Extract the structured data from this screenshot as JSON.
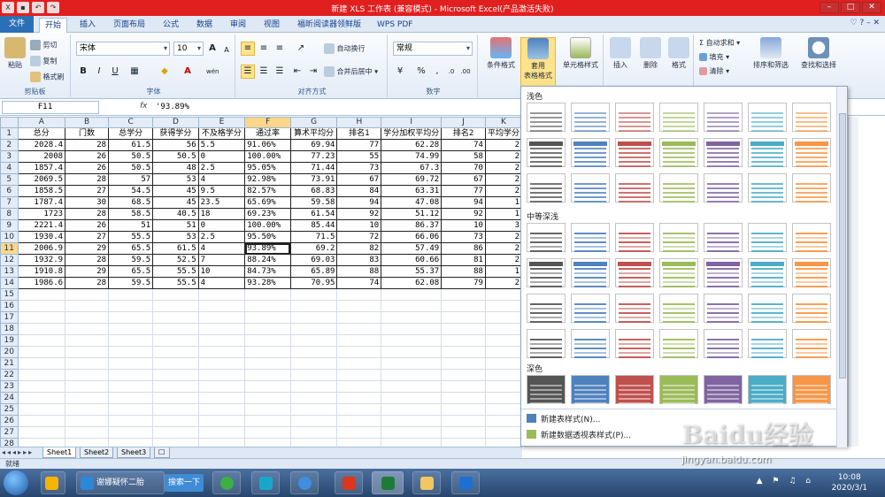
{
  "window": {
    "title": "新建 XLS 工作表 (兼容模式) - Microsoft Excel(产品激活失败)",
    "controls": [
      "–",
      "□",
      "✕"
    ]
  },
  "tabs": [
    {
      "label": "文件"
    },
    {
      "label": "开始"
    },
    {
      "label": "插入"
    },
    {
      "label": "页面布局"
    },
    {
      "label": "公式"
    },
    {
      "label": "数据"
    },
    {
      "label": "审阅"
    },
    {
      "label": "视图"
    },
    {
      "label": "福昕阅读器领鲜版"
    },
    {
      "label": "WPS PDF"
    }
  ],
  "ribbon": {
    "clipboard": {
      "label": "剪贴板",
      "paste": "粘贴",
      "cut": "剪切",
      "copy": "复制",
      "format_painter": "格式刷"
    },
    "font": {
      "label": "字体",
      "name": "宋体",
      "size": "10",
      "bold": "B",
      "italic": "I",
      "underline": "U",
      "grow": "A",
      "shrink": "A",
      "wen": "wén"
    },
    "alignment": {
      "label": "对齐方式",
      "wrap": "自动换行",
      "merge": "合并后居中"
    },
    "number": {
      "label": "数字",
      "format": "常规",
      "percent": "%",
      "comma": ","
    },
    "styles": {
      "conditional": "条件格式",
      "table_line1": "套用",
      "table_line2": "表格格式",
      "cell": "单元格样式"
    },
    "cells": {
      "insert": "插入",
      "delete": "删除",
      "format": "格式"
    },
    "editing": {
      "autosum": "自动求和",
      "fill": "填充",
      "clear": "清除",
      "sort": "排序和筛选",
      "find": "查找和选择"
    }
  },
  "formula_bar": {
    "name_box": "F11",
    "fx": "fx",
    "content": "'93.89%"
  },
  "sheet": {
    "columns": [
      "A",
      "B",
      "C",
      "D",
      "E",
      "F",
      "G",
      "H",
      "I",
      "J",
      "K"
    ],
    "header_row": [
      "总分",
      "门数",
      "总学分",
      "获得学分",
      "不及格学分",
      "通过率",
      "算术平均分",
      "排名1",
      "学分加权平均分",
      "排名2",
      "平均学分"
    ],
    "rows": [
      [
        "2028.4",
        "28",
        "61.5",
        "56",
        "5.5",
        "91.06%",
        "69.94",
        "77",
        "62.28",
        "74",
        "2"
      ],
      [
        "2008",
        "26",
        "50.5",
        "50.5",
        "0",
        "100.00%",
        "77.23",
        "55",
        "74.99",
        "58",
        "2"
      ],
      [
        "1857.4",
        "26",
        "50.5",
        "48",
        "2.5",
        "95.05%",
        "71.44",
        "73",
        "67.3",
        "70",
        "2"
      ],
      [
        "2069.5",
        "28",
        "57",
        "53",
        "4",
        "92.98%",
        "73.91",
        "67",
        "69.72",
        "67",
        "2"
      ],
      [
        "1858.5",
        "27",
        "54.5",
        "45",
        "9.5",
        "82.57%",
        "68.83",
        "84",
        "63.31",
        "77",
        "2"
      ],
      [
        "1787.4",
        "30",
        "68.5",
        "45",
        "23.5",
        "65.69%",
        "59.58",
        "94",
        "47.08",
        "94",
        "1"
      ],
      [
        "1723",
        "28",
        "58.5",
        "40.5",
        "18",
        "69.23%",
        "61.54",
        "92",
        "51.12",
        "92",
        "1"
      ],
      [
        "2221.4",
        "26",
        "51",
        "51",
        "0",
        "100.00%",
        "85.44",
        "10",
        "86.37",
        "10",
        "3"
      ],
      [
        "1930.4",
        "27",
        "55.5",
        "53",
        "2.5",
        "95.50%",
        "71.5",
        "72",
        "66.06",
        "73",
        "2"
      ],
      [
        "2006.9",
        "29",
        "65.5",
        "61.5",
        "4",
        "93.89%",
        "69.2",
        "82",
        "57.49",
        "86",
        "2"
      ],
      [
        "1932.9",
        "28",
        "59.5",
        "52.5",
        "7",
        "88.24%",
        "69.03",
        "83",
        "60.66",
        "81",
        "2"
      ],
      [
        "1910.8",
        "29",
        "65.5",
        "55.5",
        "10",
        "84.73%",
        "65.89",
        "88",
        "55.37",
        "88",
        "1"
      ],
      [
        "1986.6",
        "28",
        "59.5",
        "55.5",
        "4",
        "93.28%",
        "70.95",
        "74",
        "62.08",
        "79",
        "2"
      ]
    ],
    "row_numbers": [
      "1",
      "2",
      "3",
      "4",
      "5",
      "6",
      "7",
      "8",
      "9",
      "10",
      "11",
      "12",
      "13",
      "14",
      "15",
      "16",
      "17",
      "18",
      "19",
      "20",
      "21",
      "22",
      "23",
      "24",
      "25",
      "26",
      "27",
      "28"
    ],
    "tabs": [
      "Sheet1",
      "Sheet2",
      "Sheet3"
    ],
    "selected_column": "F",
    "selected_row": "11"
  },
  "gallery": {
    "sections": {
      "light": "浅色",
      "medium": "中等深浅",
      "dark": "深色"
    },
    "new_table_style": "新建表样式(N)...",
    "new_pivot_style": "新建数据透视表样式(P)...",
    "colors": [
      "#555555",
      "#4f81bd",
      "#c0504d",
      "#9bbb59",
      "#8064a2",
      "#4bacc6",
      "#f79646"
    ]
  },
  "status": {
    "text": "就绪"
  },
  "taskbar": {
    "items": [
      "谢娜疑怀二胎"
    ],
    "search": "搜索一下",
    "time": "10:08",
    "date": "2020/3/1"
  },
  "watermark": {
    "logo": "Baidu经验",
    "url": "jingyan.baidu.com"
  }
}
